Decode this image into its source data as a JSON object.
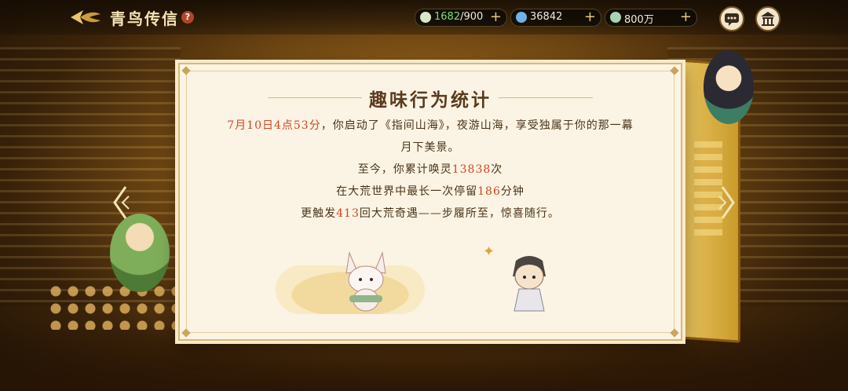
{
  "header": {
    "title": "青鸟传信",
    "help_label": "?"
  },
  "resources": [
    {
      "icon": "stamina-icon",
      "current": "1682",
      "max": "/900",
      "add_label": "+"
    },
    {
      "icon": "jade-icon",
      "value": "36842",
      "add_label": "+"
    },
    {
      "icon": "coin-icon",
      "value": "800万",
      "add_label": "+"
    }
  ],
  "top_buttons": {
    "chat_icon": "chat-icon",
    "home_icon": "home-icon"
  },
  "card": {
    "title": "趣味行为统计",
    "line1": {
      "date_time": "7月10日4点53分",
      "text_a": "，你启动了《指间山海》，夜游山海，享受独属于你的那一幕",
      "text_b": "月下美景。"
    },
    "line2": {
      "prefix": "至今，你累计唤灵",
      "value": "13838",
      "suffix": "次"
    },
    "line3": {
      "prefix": "在大荒世界中最长一次停留",
      "value": "186",
      "suffix": "分钟"
    },
    "line4": {
      "prefix": "更触发",
      "value": "413",
      "suffix": "回大荒奇遇——步履所至，惊喜随行。"
    }
  },
  "colors": {
    "highlight": "#d2441f",
    "text": "#4a3318",
    "card_bg": "#fbf4e4",
    "gold": "#caa55d"
  }
}
